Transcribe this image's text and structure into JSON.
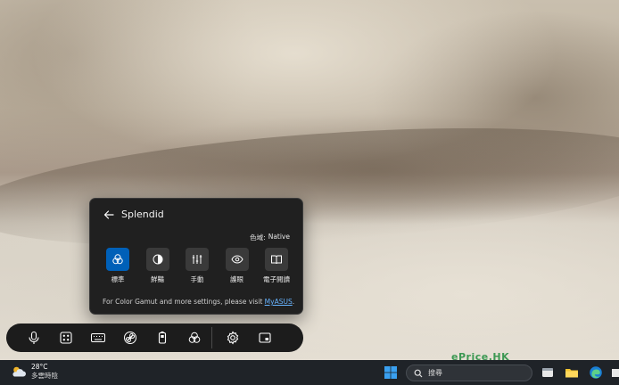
{
  "splendid": {
    "title": "Splendid",
    "gamut_label": "色域:",
    "gamut_value": "Native",
    "modes": [
      {
        "label": "標準",
        "icon": "color-circles-icon",
        "active": true
      },
      {
        "label": "鮮豔",
        "icon": "contrast-icon",
        "active": false
      },
      {
        "label": "手動",
        "icon": "sliders-icon",
        "active": false
      },
      {
        "label": "護眼",
        "icon": "eye-icon",
        "active": false
      },
      {
        "label": "電子閱讀",
        "icon": "book-icon",
        "active": false
      }
    ],
    "footer_text": "For Color Gamut and more settings, please visit",
    "footer_link": "MyASUS",
    "footer_end": "."
  },
  "controlbar": {
    "items": [
      "microphone-icon",
      "keypad-icon",
      "keyboard-icon",
      "fan-icon",
      "battery-icon",
      "color-circles-icon",
      "settings-icon",
      "display-icon"
    ]
  },
  "taskbar": {
    "weather_temp": "28°C",
    "weather_condition": "多雲時陰",
    "search_placeholder": "搜尋",
    "watermark": "ePrice.HK"
  },
  "colors": {
    "accent": "#0060b8",
    "link": "#66b3ff",
    "flyout_bg": "#202020",
    "taskbar_bg": "#1f2328"
  }
}
